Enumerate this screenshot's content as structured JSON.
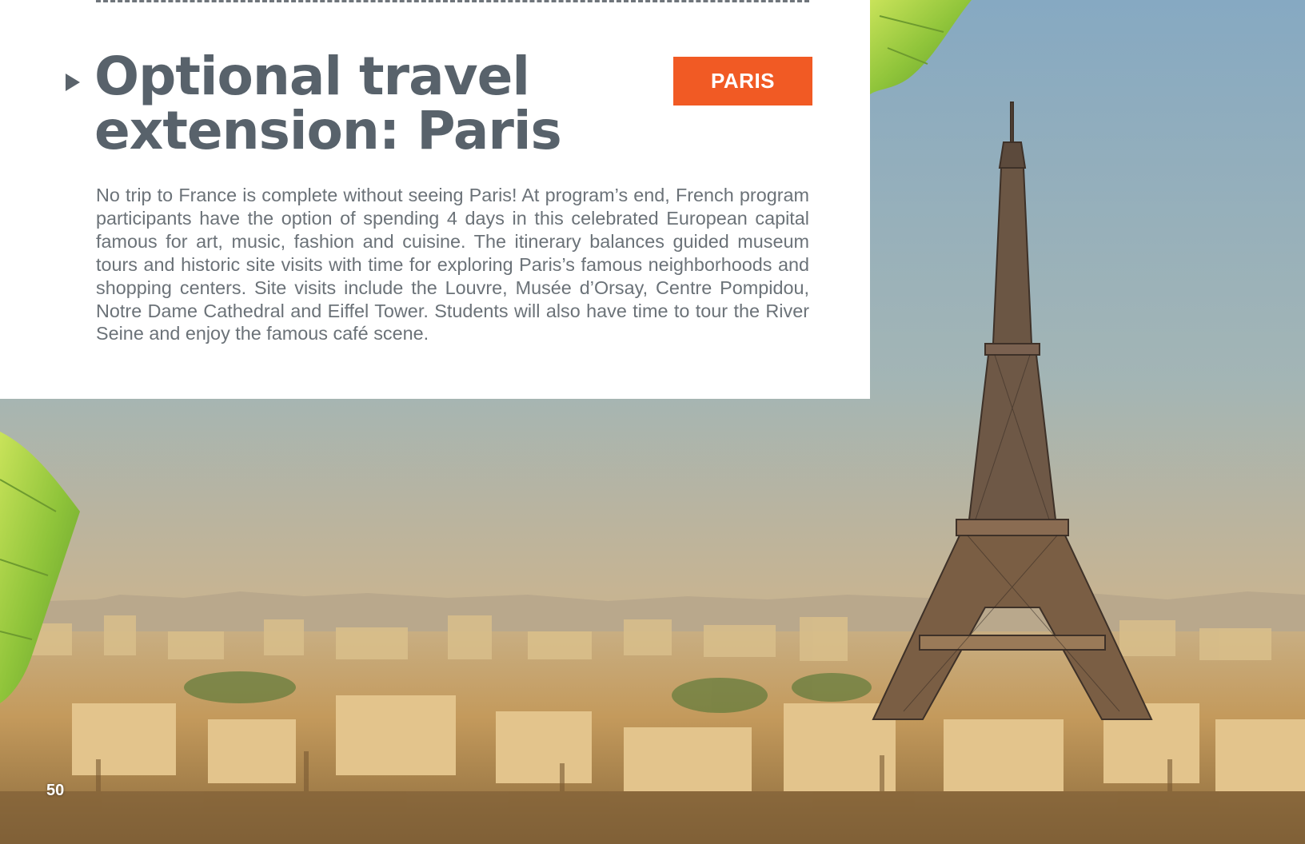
{
  "headline": {
    "line1": "Optional travel",
    "line2": "extension: Paris"
  },
  "badge": {
    "label": "PARIS"
  },
  "body": {
    "text": "No trip to France is complete without seeing Paris! At program’s end, French program participants have the option of spending 4 days in this celebrated European capital famous for art, music, fashion and cuisine. The itinerary balances guided museum tours and historic site visits with time for exploring Paris’s famous neighborhoods and shopping centers. Site visits include the Louvre, Musée d’Orsay, Centre Pompidou, Notre Dame Cathedral and Eiffel Tower. Students will also have time to tour the River Seine and enjoy the famous café scene."
  },
  "page": {
    "number": "50"
  },
  "colors": {
    "accent": "#f15a24",
    "headline": "#58626b",
    "body": "#6b7278"
  },
  "photo": {
    "subject-icons": [
      "eiffel-tower-icon",
      "city-skyline-icon",
      "chestnut-leaf-icon"
    ]
  }
}
